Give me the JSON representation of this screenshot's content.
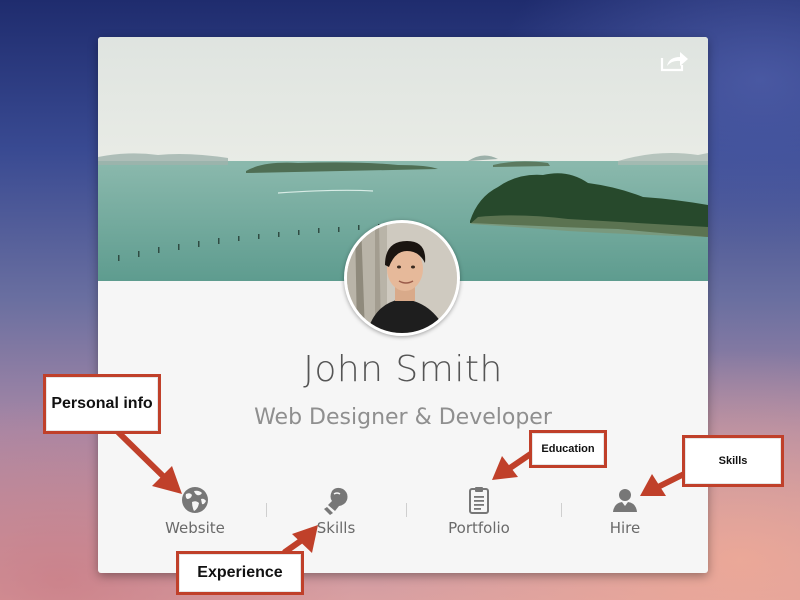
{
  "profile": {
    "name": "John Smith",
    "role": "Web Designer & Developer"
  },
  "cover": {
    "share_icon": "share-icon"
  },
  "actions": [
    {
      "label": "Website",
      "icon": "globe-icon"
    },
    {
      "label": "Skills",
      "icon": "boxing-glove-icon"
    },
    {
      "label": "Portfolio",
      "icon": "clipboard-icon"
    },
    {
      "label": "Hire",
      "icon": "user-icon"
    }
  ],
  "callouts": {
    "personal_info": "Personal info",
    "experience": "Experience",
    "education": "Education",
    "skills": "Skills"
  },
  "colors": {
    "callout_border": "#c0402a",
    "arrow": "#c0402a",
    "card_bg": "#f6f6f6",
    "icon": "#777777"
  }
}
